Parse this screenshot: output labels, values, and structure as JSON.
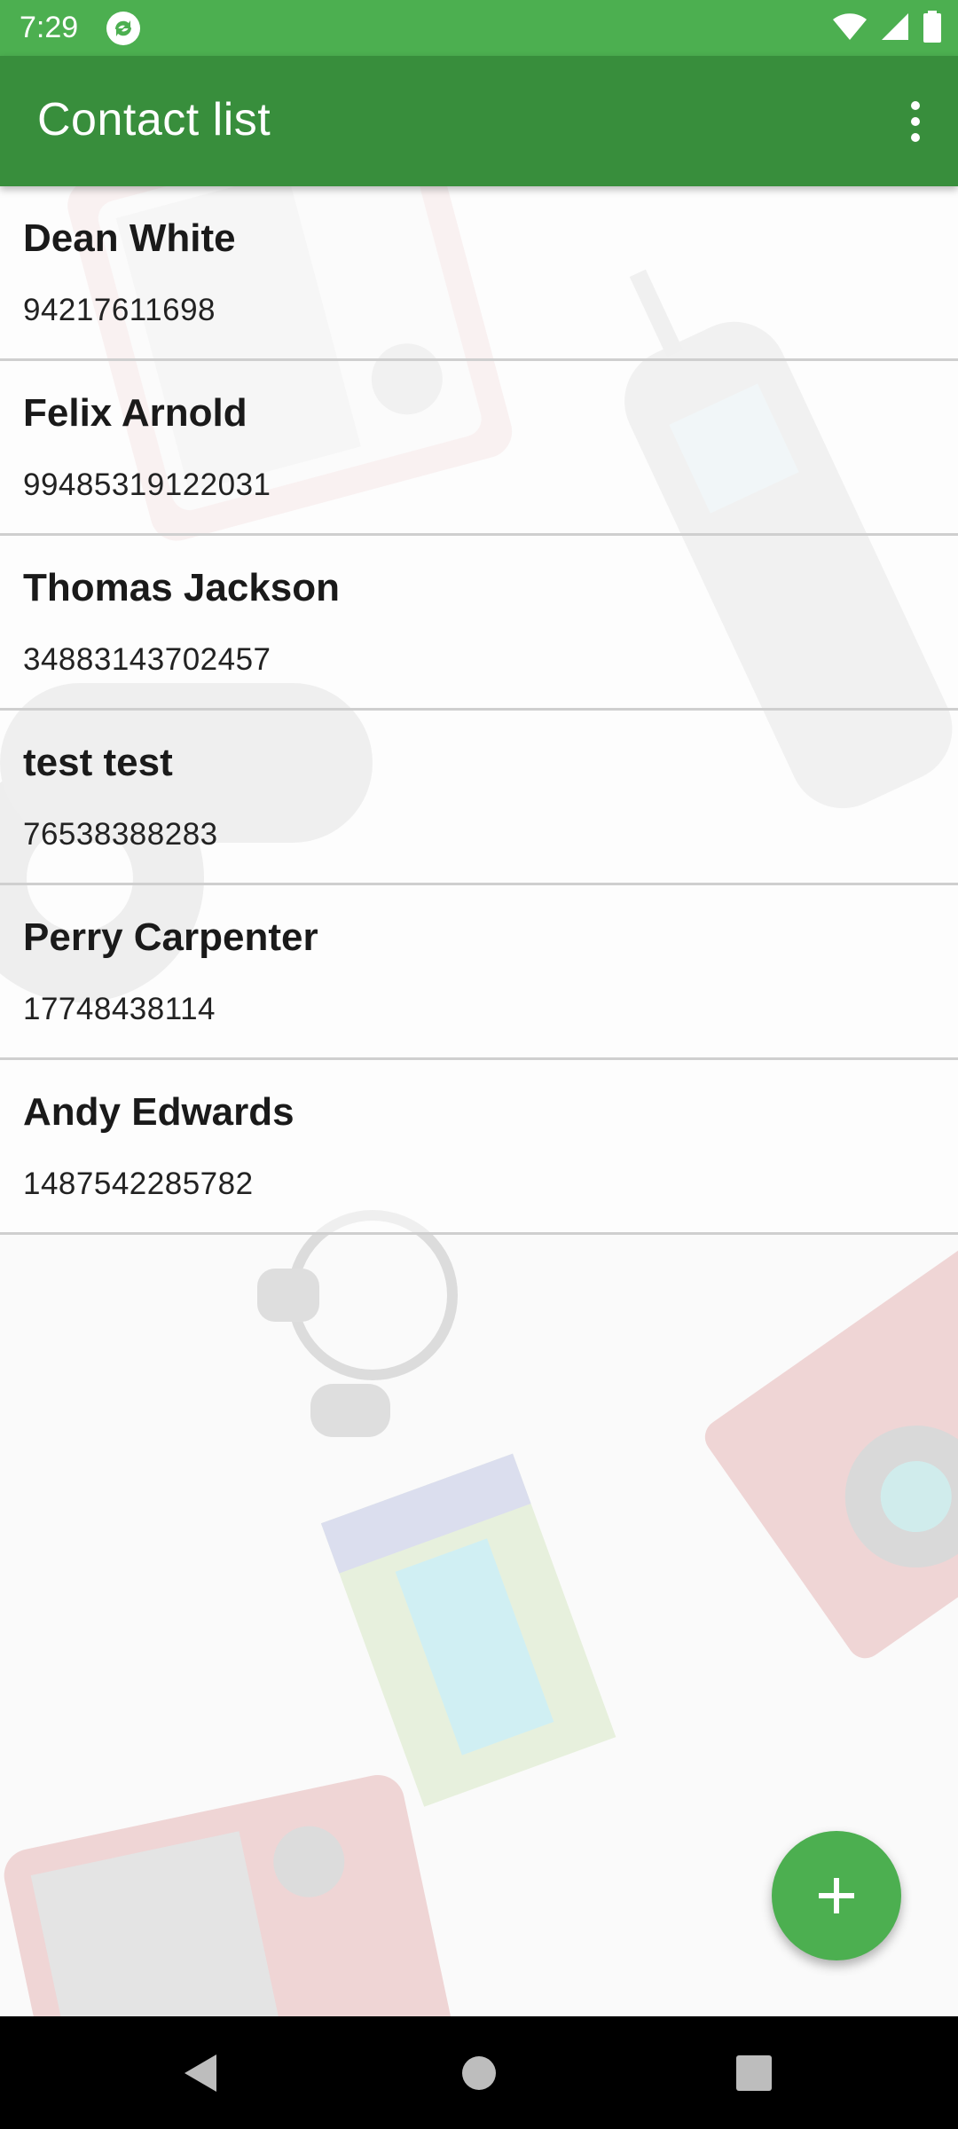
{
  "status_bar": {
    "time": "7:29",
    "icons": [
      "sync-app-icon",
      "wifi-icon",
      "cell-signal-icon",
      "battery-icon"
    ]
  },
  "app_bar": {
    "title": "Contact list",
    "overflow_icon": "more-vert-icon",
    "background_color": "#388e3c"
  },
  "contacts": [
    {
      "name": "Dean White",
      "phone": "94217611698"
    },
    {
      "name": "Felix Arnold",
      "phone": "99485319122031"
    },
    {
      "name": "Thomas Jackson",
      "phone": "34883143702457"
    },
    {
      "name": "test test",
      "phone": "76538388283"
    },
    {
      "name": "Perry Carpenter",
      "phone": "17748438114"
    },
    {
      "name": "Andy Edwards",
      "phone": "1487542285782"
    }
  ],
  "fab": {
    "icon": "plus-icon",
    "color": "#4caf50"
  },
  "nav_bar": {
    "items": [
      "back-icon",
      "home-icon",
      "recents-icon"
    ]
  },
  "colors": {
    "status_bar": "#4caf50",
    "accent": "#4caf50"
  }
}
